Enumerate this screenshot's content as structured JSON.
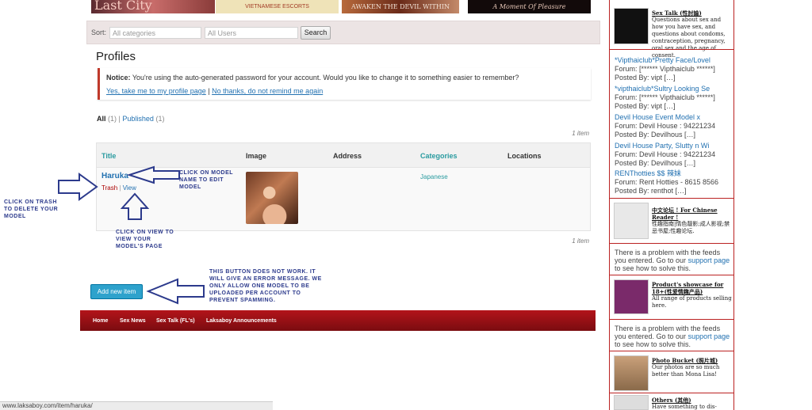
{
  "banners": {
    "b1": "Last City",
    "b2": "VIETNAMESE ESCORTS",
    "b3": "AWAKEN THE DEVIL WITHIN",
    "b4": "A Moment Of Pleasure"
  },
  "sort": {
    "label": "Sort:",
    "category_placeholder": "All categories",
    "users_placeholder": "All Users",
    "search_label": "Search"
  },
  "page_title": "Profiles",
  "notice": {
    "label": "Notice:",
    "message": "You're using the auto-generated password for your account. Would you like to change it to something easier to remember?",
    "yes_link": "Yes, take me to my profile page",
    "separator": "|",
    "no_link": "No thanks, do not remind me again"
  },
  "filters": {
    "all_label": "All",
    "all_count": "(1)",
    "sep": "|",
    "published_label": "Published",
    "published_count": "(1)"
  },
  "item_count": "1 item",
  "table": {
    "headers": [
      "Title",
      "Image",
      "Address",
      "Categories",
      "Locations"
    ],
    "rows": [
      {
        "title": "Haruka",
        "trash": "Trash",
        "sep": "|",
        "view": "View",
        "category": "Japanese"
      }
    ]
  },
  "add_button": "Add new item",
  "nav": [
    "Home",
    "Sex News",
    "Sex Talk (FL's)",
    "Laksaboy Announcements"
  ],
  "annotations": {
    "trash": [
      "CLICK ON TRASH",
      "TO DELETE YOUR",
      "MODEL"
    ],
    "edit": [
      "CLICK ON MODEL",
      "NAME TO EDIT",
      "MODEL"
    ],
    "view": [
      "CLICK ON VIEW TO",
      "VIEW YOUR",
      "MODEL'S PAGE"
    ],
    "button": [
      "THIS BUTTON DOES NOT WORK. IT",
      "WILL GIVE AN ERROR MESSAGE. WE",
      "ONLY ALLOW ONE MODEL TO BE",
      "UPLOADED PER ACCOUNT TO",
      "PREVENT SPAMMING."
    ]
  },
  "sidebar": {
    "sextalk": {
      "heading": "Sex Talk (性討論)",
      "text": "Questions about sex and how you have sex, and questions about condoms, contraception, pregnancy, oral sex and the age of consent."
    },
    "feeds": [
      {
        "title": "*Vipthaiclub*Pretty Face/Lovel",
        "forum": "Forum: [****** Vipthaiclub ******]",
        "by": "Posted By: vipt […]"
      },
      {
        "title": "*vipthaiclub*Sultry Looking Se",
        "forum": "Forum: [****** Vipthaiclub ******]",
        "by": "Posted By: vipt […]"
      },
      {
        "title": "Devil House Event Model x",
        "forum": "Forum: Devil House : 94221234",
        "by": "Posted By: Devilhous […]"
      },
      {
        "title": "Devil House Party, Slutty n Wi",
        "forum": "Forum: Devil House : 94221234",
        "by": "Posted By: Devilhous […]"
      },
      {
        "title": "RENThotties $$ 辣妹",
        "forum": "Forum: Rent Hotties - 8615 8566",
        "by": "Posted By: renthot […]"
      }
    ],
    "chinese": {
      "heading": "中文论坛 ! For Chinese Reader !",
      "text": "性趣指南|情色靓影;成人影视;禁忌书屋;性趣论坛."
    },
    "error1": {
      "pre": "There is a problem with the feeds you entered. Go to our ",
      "link": "support page",
      "post": " to see how to solve this."
    },
    "showcase": {
      "heading": "Product's showcase for 18+(性爱情趣产品)",
      "text": "All range of products selling here."
    },
    "error2": {
      "pre": "There is a problem with the feeds you entered. Go to our ",
      "link": "support page",
      "post": " to see how to solve this."
    },
    "photo": {
      "heading": "Photo Bucket (照片城)",
      "text": "Our photos are so much better than Mona Lisa!"
    },
    "others": {
      "heading": "Others (其他)",
      "text": "Have something to dis-"
    }
  },
  "status_url": "www.laksaboy.com/item/haruka/"
}
